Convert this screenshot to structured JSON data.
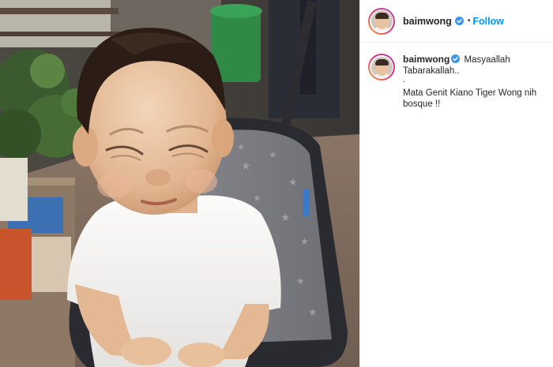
{
  "post": {
    "username": "baimwong",
    "follow_label": "Follow",
    "separator": "•",
    "caption": {
      "line1": "Masyaallah",
      "line2": "Tabarakallah..",
      "line3": ".",
      "line4": "Mata Genit Kiano Tiger Wong nih",
      "line5": "bosque !!"
    }
  },
  "icons": {
    "verified": "verified-badge-icon",
    "avatar": "profile-avatar"
  },
  "colors": {
    "follow": "#0095f6",
    "verified": "#3897f0",
    "divider": "#efefef",
    "story_ring": [
      "#f9a334",
      "#e03579",
      "#b13fc0"
    ]
  }
}
